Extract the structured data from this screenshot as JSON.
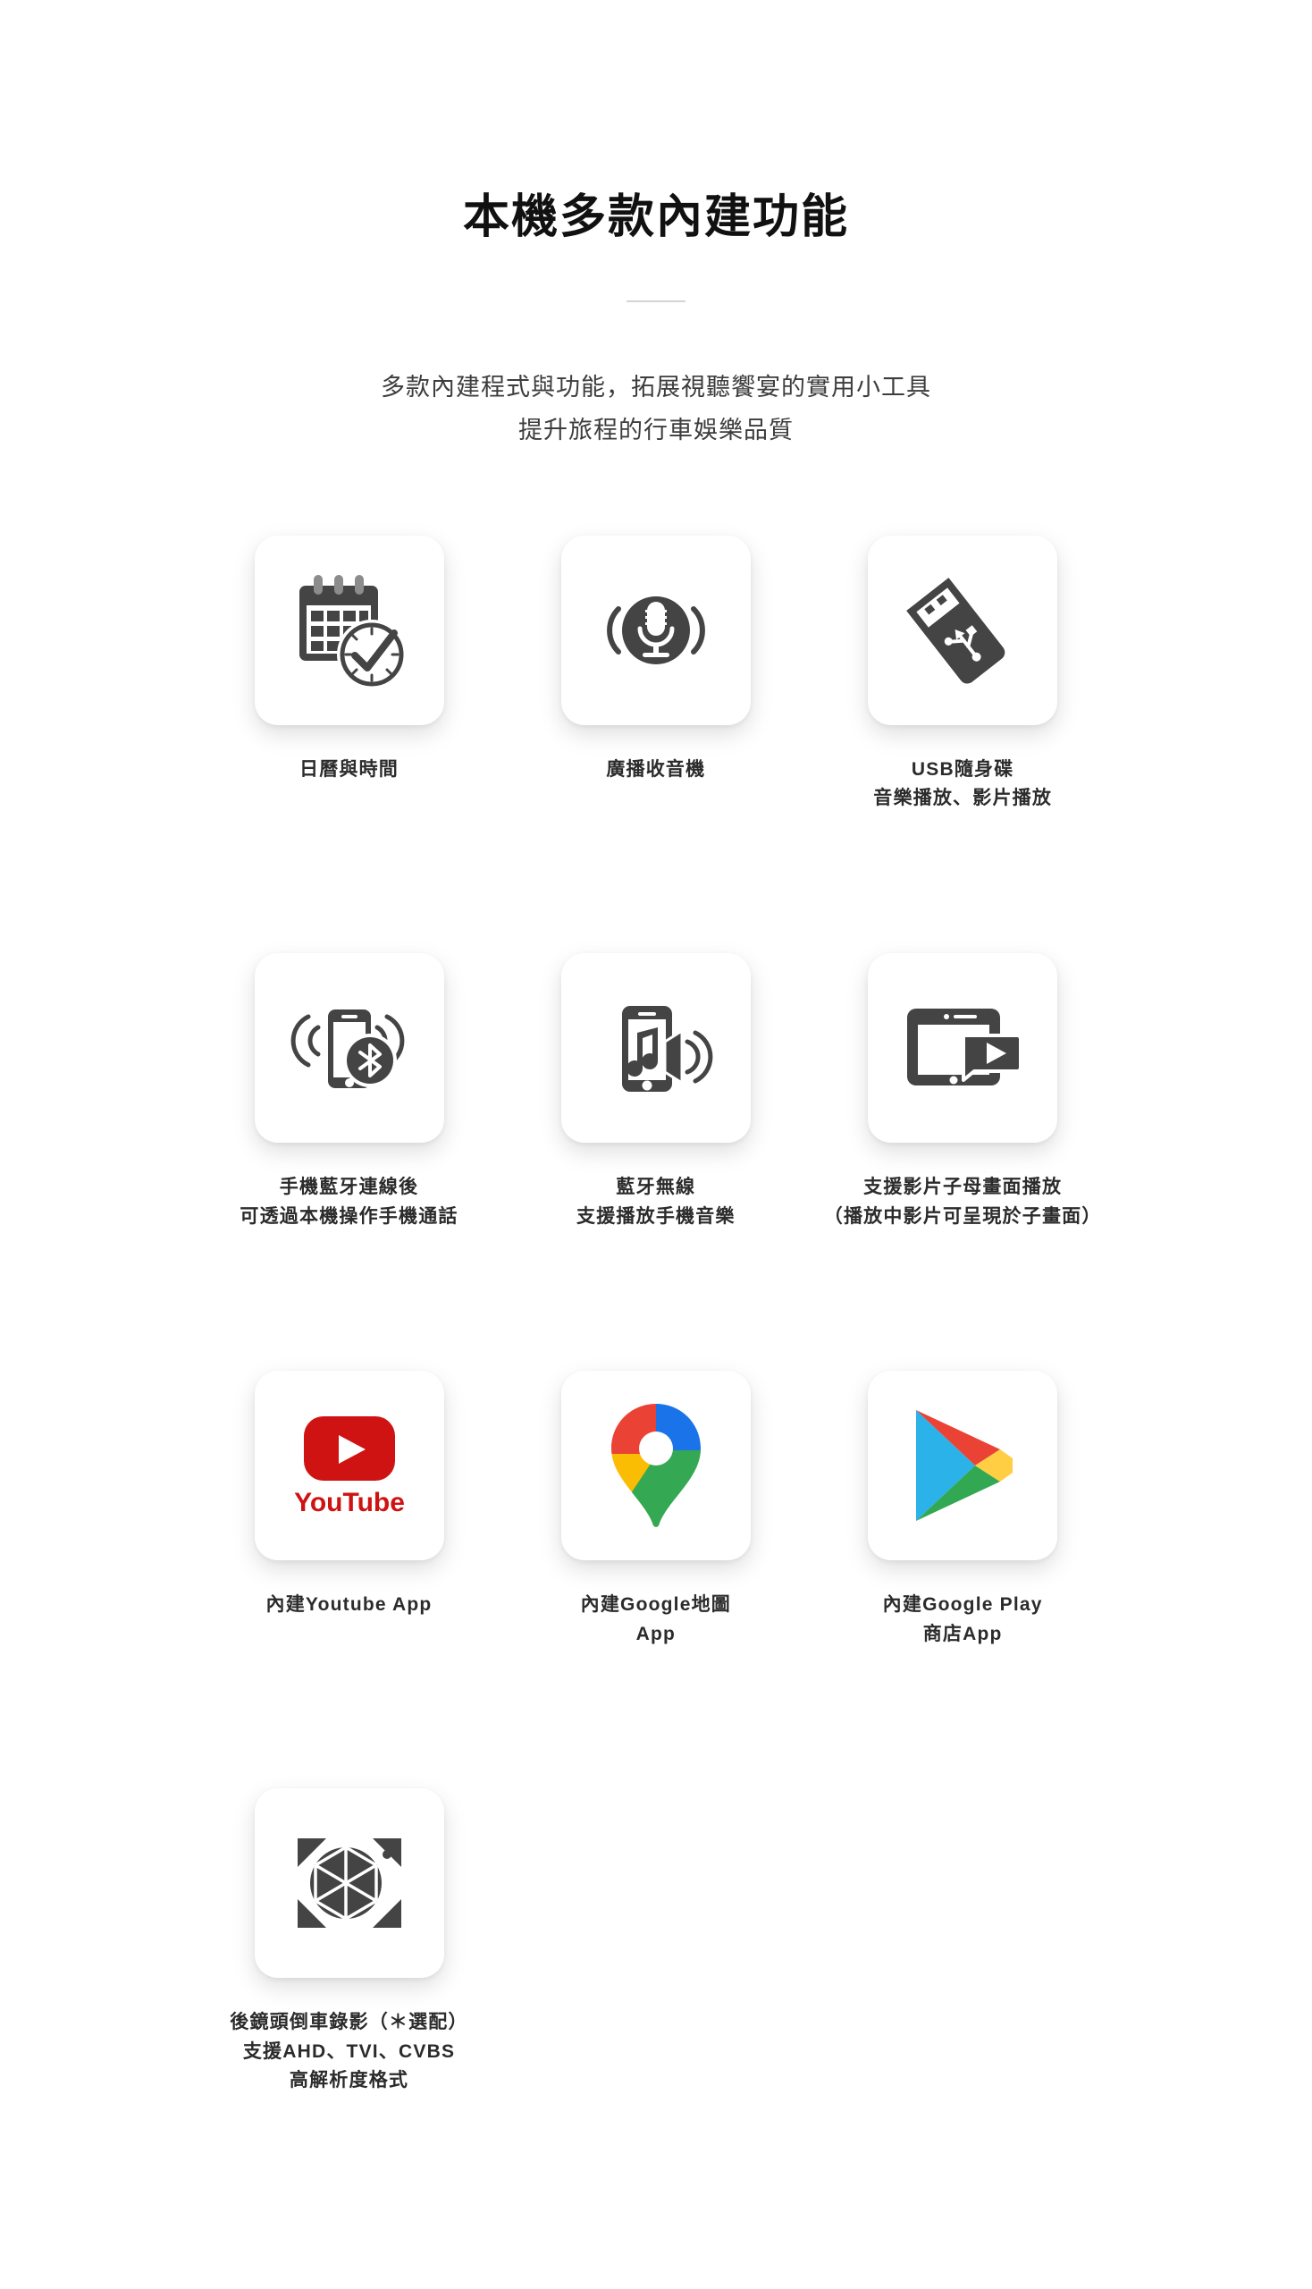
{
  "header": {
    "title": "本機多款內建功能",
    "subtitle_line1": "多款內建程式與功能，拓展視聽饗宴的實用小工具",
    "subtitle_line2": "提升旅程的行車娛樂品質"
  },
  "colors": {
    "icon_dark": "#444444",
    "text_dark": "#2b2b2b",
    "youtube_red": "#CE1312",
    "google_blue": "#1A73E8",
    "google_red": "#EA4335",
    "google_yellow": "#FBBC04",
    "google_green": "#34A853",
    "play_green": "#33A852",
    "play_yellow": "#FFCE43",
    "play_red": "#EA4335",
    "play_blue": "#2BB2E8",
    "divider": "#d4d4d4",
    "background": "#ffffff"
  },
  "features": [
    {
      "icon": "calendar-clock-icon",
      "lines": [
        "日曆與時間"
      ]
    },
    {
      "icon": "radio-microphone-icon",
      "lines": [
        "廣播收音機"
      ]
    },
    {
      "icon": "usb-flash-drive-icon",
      "lines": [
        "USB隨身碟",
        "音樂播放、影片播放"
      ]
    },
    {
      "icon": "phone-bluetooth-icon",
      "lines": [
        "手機藍牙連線後",
        "可透過本機操作手機通話"
      ]
    },
    {
      "icon": "phone-music-speaker-icon",
      "lines": [
        "藍牙無線",
        "支援播放手機音樂"
      ]
    },
    {
      "icon": "picture-in-picture-video-icon",
      "lines": [
        "支援影片子母畫面播放",
        "（播放中影片可呈現於子畫面）"
      ]
    },
    {
      "icon": "youtube-logo-icon",
      "lines": [
        "內建Youtube App"
      ],
      "wordmark": "YouTube"
    },
    {
      "icon": "google-maps-pin-icon",
      "lines": [
        "內建Google地圖",
        "App"
      ]
    },
    {
      "icon": "google-play-logo-icon",
      "lines": [
        "內建Google Play",
        "商店App"
      ]
    },
    {
      "icon": "camera-aperture-icon",
      "lines": [
        "後鏡頭倒車錄影（＊選配）",
        "支援AHD、TVI、CVBS",
        "高解析度格式"
      ]
    }
  ]
}
